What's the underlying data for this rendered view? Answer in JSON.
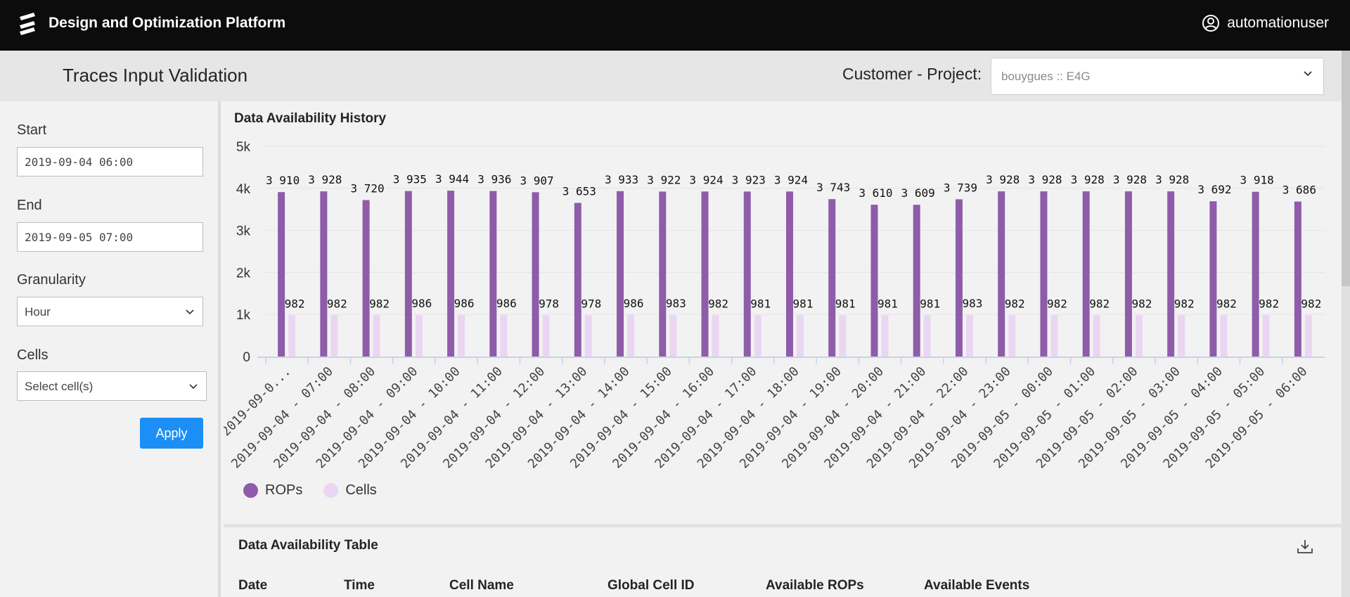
{
  "header": {
    "app_title": "Design and Optimization Platform",
    "username": "automationuser",
    "logo_icon": "ericsson-logo-icon",
    "user_icon": "user-circle-icon"
  },
  "subheader": {
    "page_title": "Traces Input Validation",
    "customer_project_label": "Customer - Project:",
    "customer_project_value": "bouygues :: E4G"
  },
  "filters": {
    "start_label": "Start",
    "start_value": "2019-09-04 06:00",
    "end_label": "End",
    "end_value": "2019-09-05 07:00",
    "granularity_label": "Granularity",
    "granularity_value": "Hour",
    "cells_label": "Cells",
    "cells_placeholder": "Select cell(s)",
    "apply_label": "Apply"
  },
  "chart_panel": {
    "title": "Data Availability History"
  },
  "chart_data": {
    "type": "bar",
    "title": "Data Availability History",
    "categories": [
      "2019-09-0...",
      "2019-09-04 - 07:00",
      "2019-09-04 - 08:00",
      "2019-09-04 - 09:00",
      "2019-09-04 - 10:00",
      "2019-09-04 - 11:00",
      "2019-09-04 - 12:00",
      "2019-09-04 - 13:00",
      "2019-09-04 - 14:00",
      "2019-09-04 - 15:00",
      "2019-09-04 - 16:00",
      "2019-09-04 - 17:00",
      "2019-09-04 - 18:00",
      "2019-09-04 - 19:00",
      "2019-09-04 - 20:00",
      "2019-09-04 - 21:00",
      "2019-09-04 - 22:00",
      "2019-09-04 - 23:00",
      "2019-09-05 - 00:00",
      "2019-09-05 - 01:00",
      "2019-09-05 - 02:00",
      "2019-09-05 - 03:00",
      "2019-09-05 - 04:00",
      "2019-09-05 - 05:00",
      "2019-09-05 - 06:00"
    ],
    "series": [
      {
        "name": "ROPs",
        "color": "#8e5ca9",
        "values": [
          3910,
          3928,
          3720,
          3935,
          3944,
          3936,
          3907,
          3653,
          3933,
          3922,
          3924,
          3923,
          3924,
          3743,
          3610,
          3609,
          3739,
          3928,
          3928,
          3928,
          3928,
          3928,
          3692,
          3918,
          3686
        ],
        "labels": [
          "3 910",
          "3 928",
          "3 720",
          "3 935",
          "3 944",
          "3 936",
          "3 907",
          "3 653",
          "3 933",
          "3 922",
          "3 924",
          "3 923",
          "3 924",
          "3 743",
          "3 610",
          "3 609",
          "3 739",
          "3 928",
          "3 928",
          "3 928",
          "3 928",
          "3 928",
          "3 692",
          "3 918",
          "3 686"
        ]
      },
      {
        "name": "Cells",
        "color": "#ead6f3",
        "values": [
          982,
          982,
          982,
          986,
          986,
          986,
          978,
          978,
          986,
          983,
          982,
          981,
          981,
          981,
          981,
          981,
          983,
          982,
          982,
          982,
          982,
          982,
          982,
          982,
          982
        ],
        "labels": [
          "982",
          "982",
          "982",
          "986",
          "986",
          "986",
          "978",
          "978",
          "986",
          "983",
          "982",
          "981",
          "981",
          "981",
          "981",
          "981",
          "983",
          "982",
          "982",
          "982",
          "982",
          "982",
          "982",
          "982",
          "982"
        ]
      }
    ],
    "ylim": [
      0,
      5000
    ],
    "yticks": [
      0,
      1000,
      2000,
      3000,
      4000,
      5000
    ],
    "ytick_labels": [
      "0",
      "1k",
      "2k",
      "3k",
      "4k",
      "5k"
    ],
    "grid": true,
    "legend": "bottom-left"
  },
  "table_panel": {
    "title": "Data Availability Table",
    "download_icon": "download-icon",
    "columns": [
      "Date",
      "Time",
      "Cell Name",
      "Global Cell ID",
      "Available ROPs",
      "Available Events"
    ]
  }
}
